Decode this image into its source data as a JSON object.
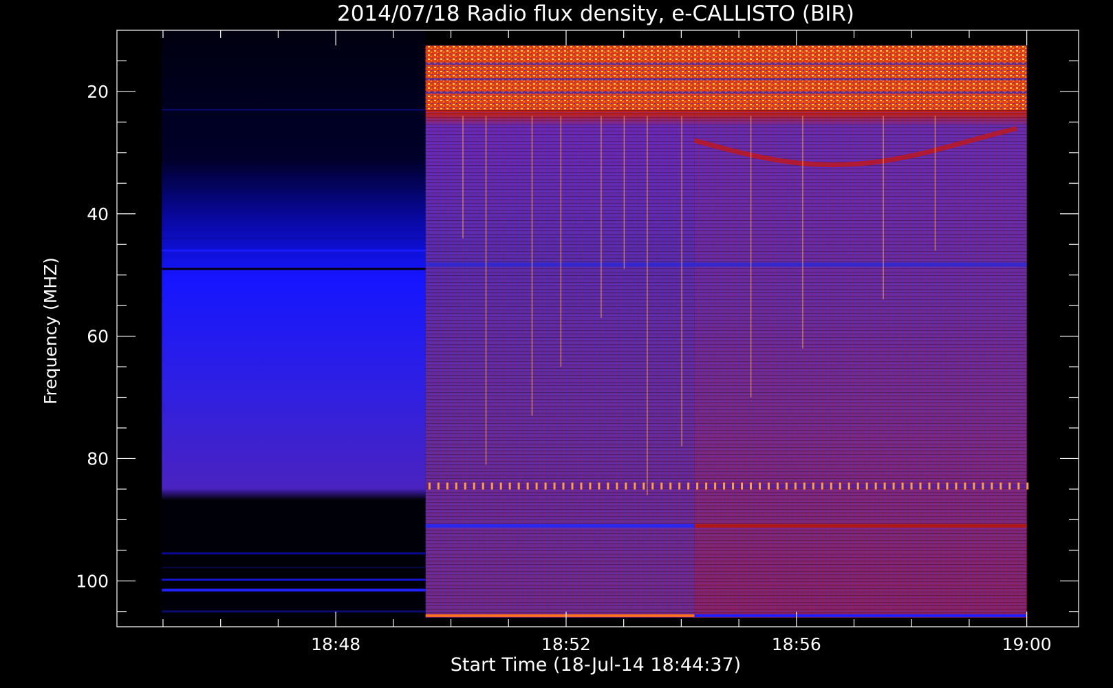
{
  "chart_data": {
    "type": "heatmap",
    "title": "2014/07/18  Radio flux density, e-CALLISTO (BIR)",
    "xlabel": "Start Time (18-Jul-14 18:44:37)",
    "ylabel": "Frequency (MHZ)",
    "x_tick_labels": [
      "18:48",
      "18:52",
      "18:56",
      "19:00"
    ],
    "x_ticks_minutes_after_1844": [
      4,
      8,
      12,
      16
    ],
    "xlim_minutes_after_1844": [
      0.2,
      16.9
    ],
    "y_tick_labels": [
      "20",
      "40",
      "60",
      "80",
      "100"
    ],
    "y_ticks": [
      20,
      40,
      60,
      80,
      100
    ],
    "ylim": [
      10,
      107.5
    ],
    "y_inverted": true,
    "grid": false,
    "colormap": [
      "#000000",
      "#1010ff",
      "#8020a0",
      "#c01010",
      "#ff6010",
      "#ffd060"
    ],
    "segments": [
      {
        "name": "pre-observation",
        "start_min": 0.98,
        "end_min": 5.56,
        "freq_range": [
          22,
          106
        ],
        "mean_level": "low"
      },
      {
        "name": "observation-part-1",
        "start_min": 5.56,
        "end_min": 10.23,
        "freq_range": [
          12.5,
          106
        ],
        "mean_level": "medium"
      },
      {
        "name": "observation-part-2",
        "start_min": 10.23,
        "end_min": 16.0,
        "freq_range": [
          12.5,
          106
        ],
        "mean_level": "medium"
      }
    ],
    "features": [
      {
        "name": "intense-band-low-freq",
        "freq_range": [
          12.5,
          23
        ],
        "start_min": 5.56,
        "end_min": 16.0,
        "level": "high"
      },
      {
        "name": "periodic-bursts",
        "freq": 84.5,
        "start_min": 5.56,
        "end_min": 16.0,
        "level": "high"
      },
      {
        "name": "drifting-stripe",
        "freq_range": [
          25,
          35
        ],
        "start_min": 10.23,
        "end_min": 16.0,
        "level": "medium-high"
      }
    ]
  }
}
